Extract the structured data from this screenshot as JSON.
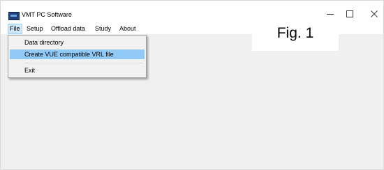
{
  "window": {
    "title": "VMT PC Software",
    "minimize_icon": "minimize-icon",
    "maximize_icon": "maximize-icon",
    "close_icon": "close-icon"
  },
  "menubar": {
    "items": [
      {
        "label": "File"
      },
      {
        "label": "Setup"
      },
      {
        "label": "Offload data"
      },
      {
        "label": "Study"
      },
      {
        "label": "About"
      }
    ]
  },
  "file_menu": {
    "items": [
      {
        "label": "Data directory"
      },
      {
        "label": "Create VUE compatible VRL file"
      },
      {
        "label": "Exit"
      }
    ]
  },
  "figure_label": "Fig. 1"
}
